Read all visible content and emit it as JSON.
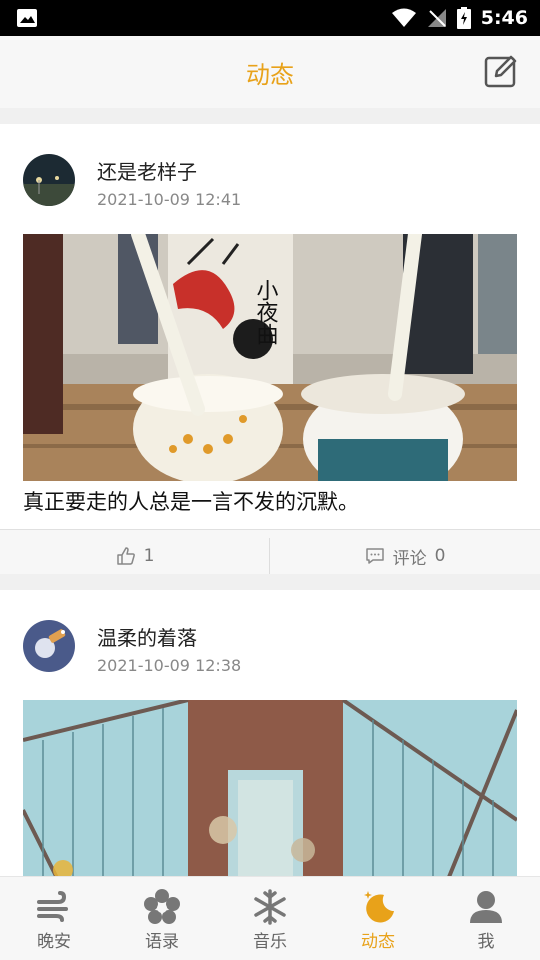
{
  "status_bar": {
    "time": "5:46"
  },
  "header": {
    "title": "动态"
  },
  "posts": [
    {
      "username": "还是老样子",
      "timestamp": "2021-10-09 12:41",
      "caption": "真正要走的人总是一言不发的沉默。",
      "image_text": "小夜曲",
      "likes": "1",
      "comment_label": "评论",
      "comments": "0"
    },
    {
      "username": "温柔的着落",
      "timestamp": "2021-10-09 12:38"
    }
  ],
  "tabs": [
    {
      "label": "晚安",
      "icon": "wind-icon"
    },
    {
      "label": "语录",
      "icon": "flower-icon"
    },
    {
      "label": "音乐",
      "icon": "snowflake-icon"
    },
    {
      "label": "动态",
      "icon": "moon-stars-icon",
      "active": true
    },
    {
      "label": "我",
      "icon": "user-icon"
    }
  ],
  "colors": {
    "accent": "#e8a21a",
    "inactive": "#777777"
  }
}
